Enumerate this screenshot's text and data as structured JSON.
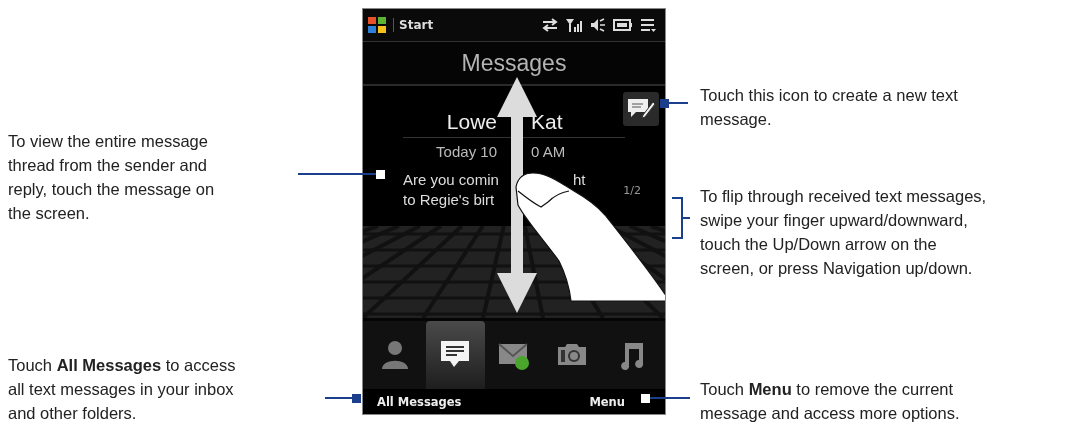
{
  "phone": {
    "status_bar": {
      "start_label": "Start"
    },
    "title": "Messages",
    "message": {
      "sender_parts": [
        "Lowe",
        "Kat"
      ],
      "time_parts": [
        "Today 10",
        "0 AM"
      ],
      "body_lines": [
        [
          "Are you comin",
          "ht"
        ],
        [
          "to Regie's birt"
        ]
      ],
      "counter": "1/2"
    },
    "tabs": [
      {
        "kind": "contact",
        "selected": false
      },
      {
        "kind": "messages",
        "selected": true
      },
      {
        "kind": "mail",
        "selected": false
      },
      {
        "kind": "camera",
        "selected": false
      },
      {
        "kind": "music",
        "selected": false
      }
    ],
    "softkeys": {
      "left": "All Messages",
      "right": "Menu"
    }
  },
  "left_callouts": [
    {
      "lines": [
        "To view the entire message",
        "thread from the sender and",
        "reply, touch the message on",
        "the screen."
      ]
    },
    {
      "lines": [
        "Touch **All Messages** to access",
        "all text messages in your inbox",
        "and other folders."
      ]
    }
  ],
  "right_callouts": [
    {
      "lines": [
        "Touch this icon to create a new text",
        "message."
      ]
    },
    {
      "lines": [
        "To flip through received text messages,",
        "swipe your finger upward/downward,",
        "touch the Up/Down arrow on the",
        "screen, or press Navigation up/down."
      ]
    },
    {
      "lines": [
        "Touch **Menu** to remove the current",
        "message and access more options."
      ]
    }
  ]
}
